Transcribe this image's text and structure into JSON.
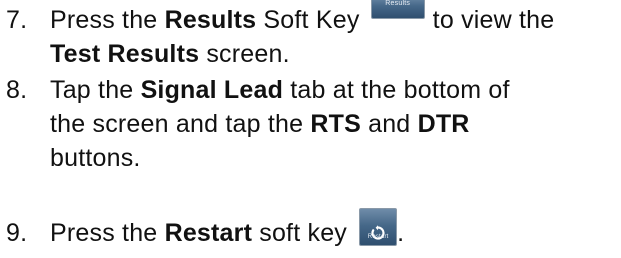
{
  "steps": [
    {
      "number": "7.",
      "lines": [
        {
          "t1": "Press the ",
          "b1": "Results",
          "t2": " Soft Key ",
          "softkey_label": "Results",
          "t3": "to view the"
        },
        {
          "b1": "Test Results",
          "t2": " screen."
        }
      ]
    },
    {
      "number": "8.",
      "lines": [
        {
          "t1": "Tap the ",
          "b1": "Signal Lead",
          "t2": " tab at the bottom of"
        },
        {
          "t1": "the screen and tap the ",
          "b1": "RTS",
          "t2": " and ",
          "b2": "DTR"
        },
        {
          "t1": "buttons."
        }
      ]
    },
    {
      "number": "9.",
      "lines": [
        {
          "t1": "Press the ",
          "b1": "Restart",
          "t2": " soft key ",
          "softkey_label": "Restart",
          "softkey_icon": "restart-icon",
          "t3": "."
        }
      ]
    }
  ],
  "colors": {
    "text": "#111111",
    "softkey_top": "#6f8ca9",
    "softkey_bottom": "#2f4f6f",
    "softkey_text": "#e8eef5"
  }
}
